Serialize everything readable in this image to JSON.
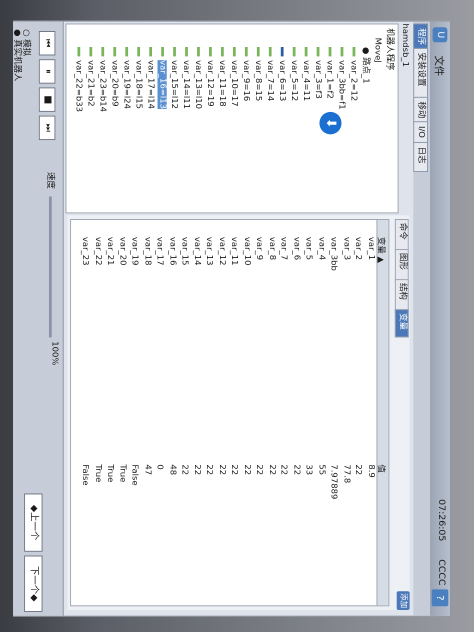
{
  "window": {
    "file_menu": "文件",
    "clock": "07:26:05",
    "status_code": "CCCC",
    "help": "?"
  },
  "tabs": {
    "program": "程序",
    "install": "安装设置",
    "move": "移动",
    "io": "I/O",
    "log": "日志"
  },
  "file_label": "hamdsb_1",
  "tree": [
    {
      "label": "机器人程序",
      "indent": 0,
      "bullet": false
    },
    {
      "label": "MoveJ",
      "indent": 1,
      "bullet": false
    },
    {
      "label": "● 路点_1",
      "indent": 2,
      "bullet": false
    },
    {
      "label": "var_2=12",
      "indent": 2,
      "bullet": true
    },
    {
      "label": "var_3bb=f1",
      "indent": 2,
      "bullet": true
    },
    {
      "label": "var_1=f2",
      "indent": 2,
      "bullet": true
    },
    {
      "label": "var_3=f3",
      "indent": 2,
      "bullet": true
    },
    {
      "label": "var_4=11",
      "indent": 2,
      "bullet": true
    },
    {
      "label": "var_5=12",
      "indent": 2,
      "bullet": true
    },
    {
      "label": "var_6=13",
      "indent": 2,
      "bullet": true,
      "blue": true
    },
    {
      "label": "var_7=14",
      "indent": 2,
      "bullet": true
    },
    {
      "label": "var_8=15",
      "indent": 2,
      "bullet": true
    },
    {
      "label": "var_9=16",
      "indent": 2,
      "bullet": true
    },
    {
      "label": "var_10=17",
      "indent": 2,
      "bullet": true
    },
    {
      "label": "var_11=18",
      "indent": 2,
      "bullet": true
    },
    {
      "label": "var_12=19",
      "indent": 2,
      "bullet": true
    },
    {
      "label": "var_13=l10",
      "indent": 2,
      "bullet": true
    },
    {
      "label": "var_14=l11",
      "indent": 2,
      "bullet": true
    },
    {
      "label": "var_15=l12",
      "indent": 2,
      "bullet": true
    },
    {
      "label": "var_16=l13",
      "indent": 2,
      "bullet": true,
      "selected": true
    },
    {
      "label": "var_17=l14",
      "indent": 2,
      "bullet": true
    },
    {
      "label": "var_18=l15",
      "indent": 2,
      "bullet": true
    },
    {
      "label": "var_19=l24",
      "indent": 2,
      "bullet": true
    },
    {
      "label": "var_20=b9",
      "indent": 2,
      "bullet": true
    },
    {
      "label": "var_23=b14",
      "indent": 2,
      "bullet": true
    },
    {
      "label": "var_21=b2",
      "indent": 2,
      "bullet": true
    },
    {
      "label": "var_22=b33",
      "indent": 2,
      "bullet": true
    }
  ],
  "subtabs": {
    "command": "命令",
    "graphics": "图形",
    "structure": "结构",
    "variables": "变量"
  },
  "table": {
    "header_var": "变量 ▲",
    "header_val": "值",
    "rows": [
      {
        "name": "var_1",
        "value": "8.9"
      },
      {
        "name": "var_2",
        "value": "22"
      },
      {
        "name": "var_3",
        "value": "77.8"
      },
      {
        "name": "var_3bb",
        "value": "7.97889"
      },
      {
        "name": "var_4",
        "value": "55"
      },
      {
        "name": "var_5",
        "value": "33"
      },
      {
        "name": "var_6",
        "value": "22"
      },
      {
        "name": "var_7",
        "value": "22"
      },
      {
        "name": "var_8",
        "value": "22"
      },
      {
        "name": "var_9",
        "value": "22"
      },
      {
        "name": "var_10",
        "value": "22"
      },
      {
        "name": "var_11",
        "value": "22"
      },
      {
        "name": "var_12",
        "value": "22"
      },
      {
        "name": "var_13",
        "value": "22"
      },
      {
        "name": "var_14",
        "value": "22"
      },
      {
        "name": "var_15",
        "value": "22"
      },
      {
        "name": "var_16",
        "value": "48"
      },
      {
        "name": "var_17",
        "value": "0"
      },
      {
        "name": "var_18",
        "value": "47"
      },
      {
        "name": "var_19",
        "value": "False"
      },
      {
        "name": "var_20",
        "value": "True"
      },
      {
        "name": "var_21",
        "value": "True"
      },
      {
        "name": "var_22",
        "value": "True"
      },
      {
        "name": "var_23",
        "value": "False"
      }
    ]
  },
  "add_button": "添加",
  "speed": {
    "label": "速度",
    "value": "100%"
  },
  "buttons": {
    "prev": "◆上一个",
    "next": "下一个◆"
  },
  "status": {
    "simulation": "模拟",
    "real_robot": "真实机器人"
  }
}
